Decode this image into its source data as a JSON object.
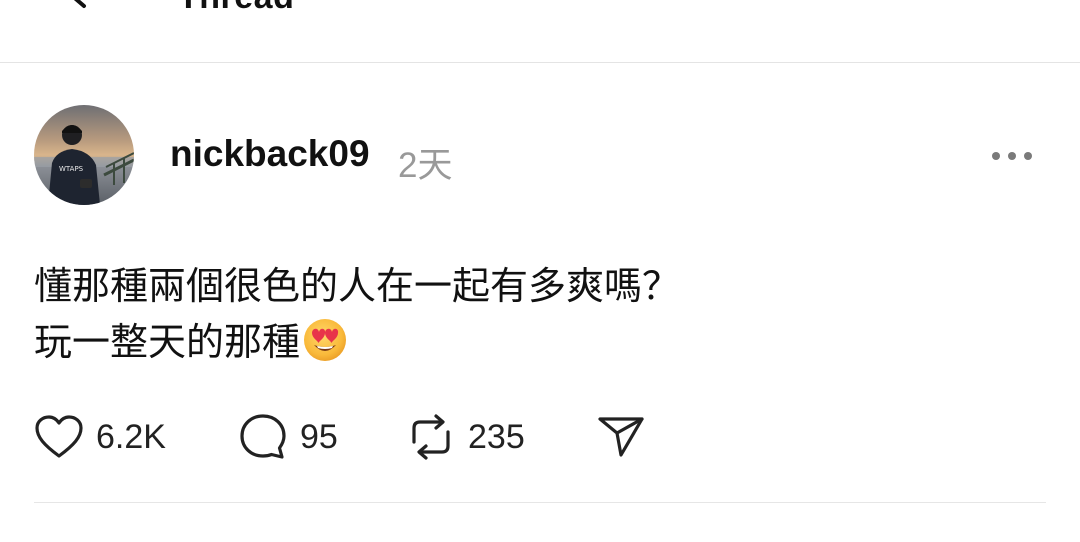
{
  "header": {
    "title": "Thread",
    "back_icon": "back-arrow-icon"
  },
  "post": {
    "username": "nickback09",
    "timestamp": "2天",
    "lines": [
      "懂那種兩個很色的人在一起有多爽嗎？",
      "玩一整天的那種"
    ],
    "emoji": "heart-eyes-emoji",
    "more_icon": "more-dots-icon"
  },
  "actions": {
    "like_count": "6.2K",
    "reply_count": "95",
    "repost_count": "235",
    "icons": [
      "heart-icon",
      "comment-icon",
      "repost-icon",
      "share-icon"
    ]
  },
  "colors": {
    "text": "#111111",
    "muted": "#999999",
    "divider": "#e4e4e4"
  }
}
